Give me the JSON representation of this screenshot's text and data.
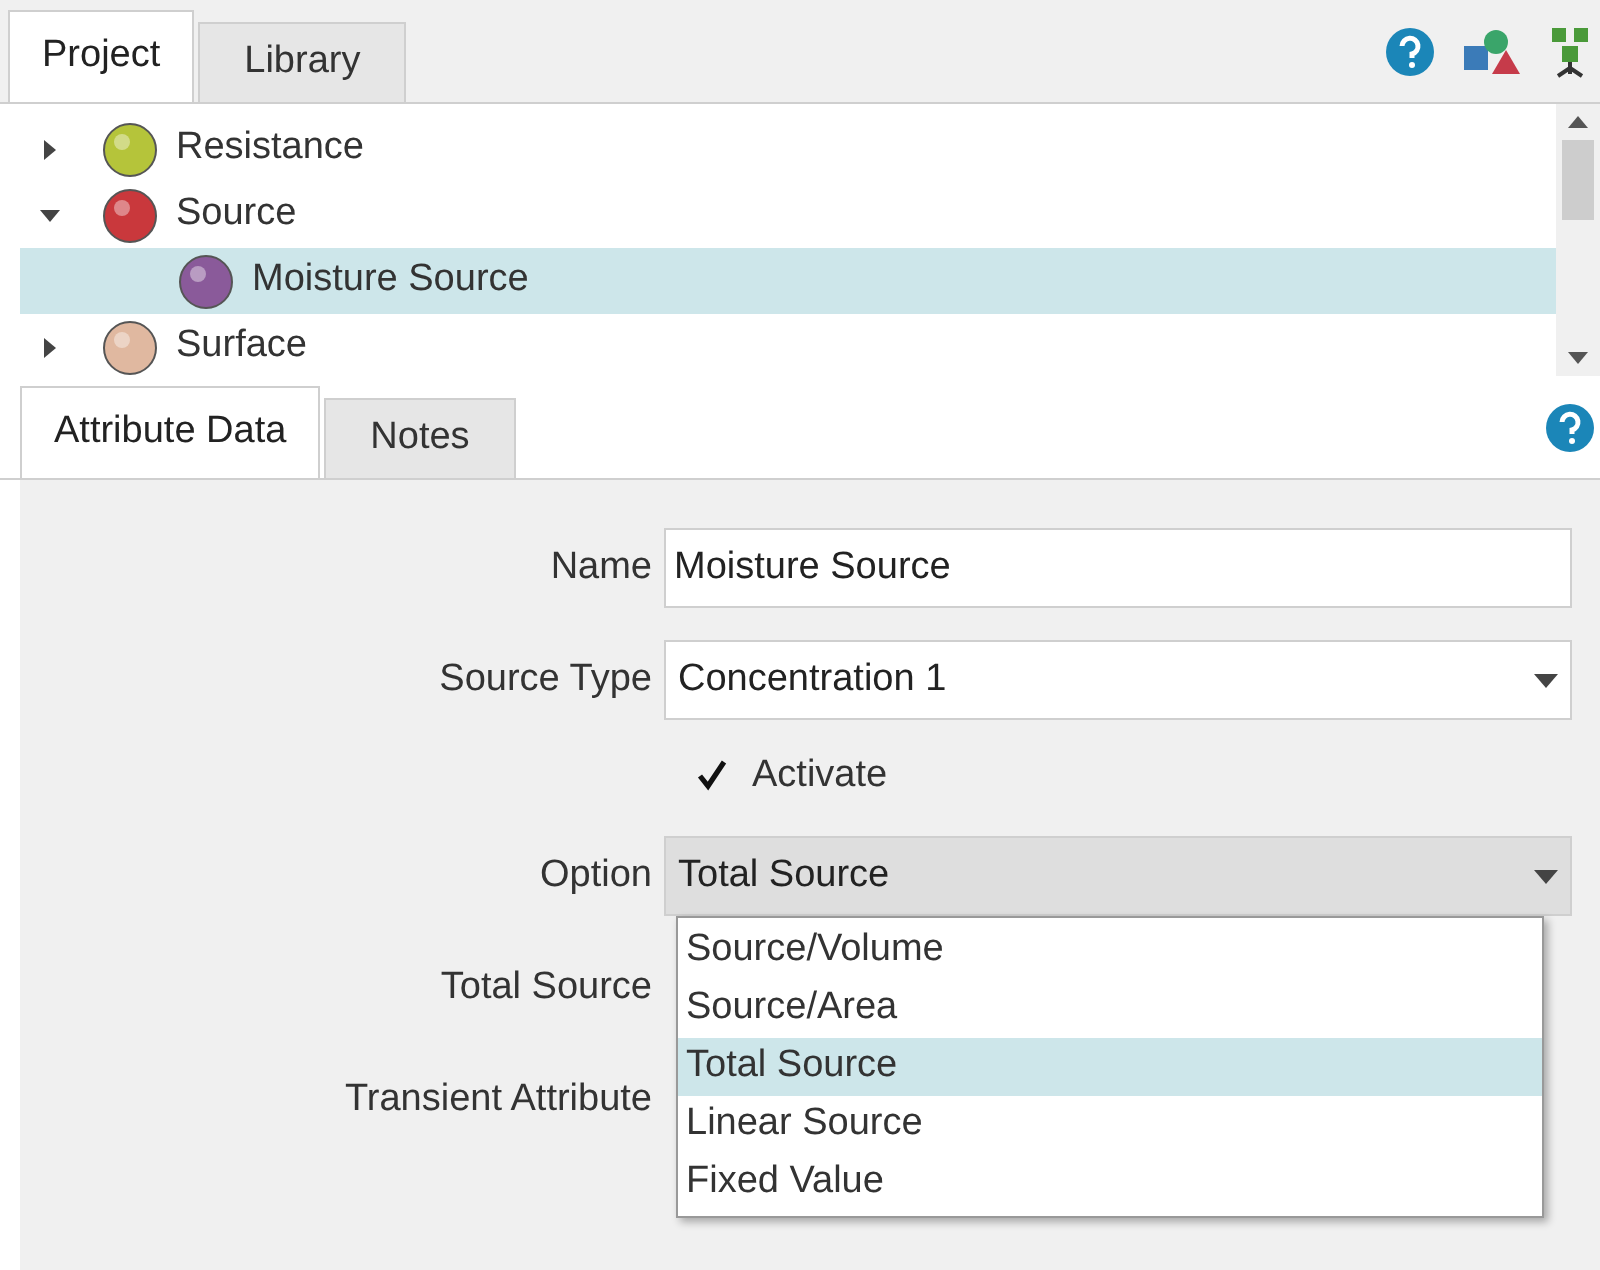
{
  "top_tabs": [
    {
      "label": "Project",
      "selected": true
    },
    {
      "label": "Library",
      "selected": false
    }
  ],
  "tree": [
    {
      "label": "Resistance",
      "color": "#b5c43a",
      "expanded": false,
      "selected": false
    },
    {
      "label": "Source",
      "color": "#c9383c",
      "expanded": true,
      "selected": false,
      "children": [
        {
          "label": "Moisture Source",
          "color": "#8a5a9a",
          "selected": true
        }
      ]
    },
    {
      "label": "Surface",
      "color": "#e0b8a0",
      "expanded": false,
      "selected": false
    }
  ],
  "attr_tabs": [
    {
      "label": "Attribute Data",
      "selected": true
    },
    {
      "label": "Notes",
      "selected": false
    }
  ],
  "form": {
    "name": {
      "label": "Name",
      "value": "Moisture Source"
    },
    "source_type": {
      "label": "Source Type",
      "value": "Concentration 1"
    },
    "activate": {
      "label": "Activate",
      "checked": true
    },
    "option": {
      "label": "Option",
      "value": "Total Source",
      "expanded": true,
      "options": [
        {
          "label": "Source/Volume",
          "selected": false
        },
        {
          "label": "Source/Area",
          "selected": false
        },
        {
          "label": "Total Source",
          "selected": true
        },
        {
          "label": "Linear Source",
          "selected": false
        },
        {
          "label": "Fixed Value",
          "selected": false
        }
      ]
    },
    "total_source": {
      "label": "Total Source"
    },
    "transient_attribute": {
      "label": "Transient Attribute"
    }
  }
}
